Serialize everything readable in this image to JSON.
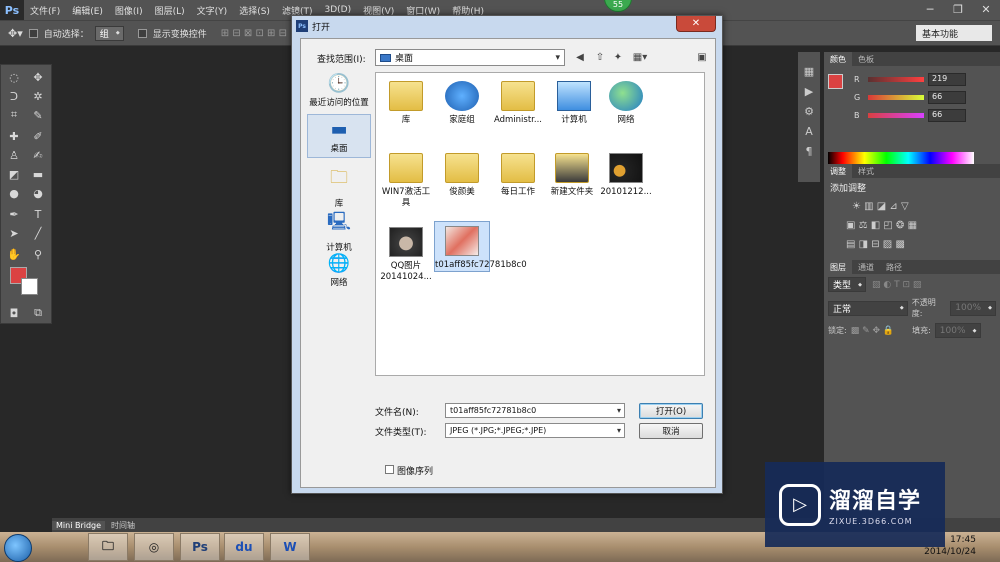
{
  "app": {
    "logo": "Ps",
    "badge": "55"
  },
  "menubar": [
    "文件(F)",
    "编辑(E)",
    "图像(I)",
    "图层(L)",
    "文字(Y)",
    "选择(S)",
    "滤镜(T)",
    "3D(D)",
    "视图(V)",
    "窗口(W)",
    "帮助(H)"
  ],
  "options": {
    "auto_select": "自动选择：",
    "group": "组",
    "show_transform": "显示变换控件"
  },
  "workspace": "基本功能",
  "color_panel": {
    "tabs": [
      "颜色",
      "色板"
    ],
    "channels": [
      {
        "label": "R",
        "value": "219"
      },
      {
        "label": "G",
        "value": "66"
      },
      {
        "label": "B",
        "value": "66"
      }
    ],
    "fg_color": "#db4242"
  },
  "adjust_panel": {
    "tabs": [
      "调整",
      "样式"
    ],
    "title": "添加调整"
  },
  "layers_panel": {
    "tabs": [
      "图层",
      "通道",
      "路径"
    ],
    "kind": "类型",
    "blend": "正常",
    "opacity_label": "不透明度:",
    "opacity": "100%",
    "lock_label": "锁定:",
    "fill_label": "填充:",
    "fill": "100%"
  },
  "bottom_tabs": [
    "Mini Bridge",
    "时间轴"
  ],
  "dialog": {
    "title": "打开",
    "lookin_label": "查找范围(I):",
    "lookin_value": "桌面",
    "places": [
      {
        "label": "最近访问的位置",
        "icon": "recent-places-icon"
      },
      {
        "label": "桌面",
        "icon": "desktop-icon"
      },
      {
        "label": "库",
        "icon": "libraries-icon"
      },
      {
        "label": "计算机",
        "icon": "computer-icon"
      },
      {
        "label": "网络",
        "icon": "network-icon"
      }
    ],
    "files": [
      {
        "label": "库",
        "icon": "libraries-icon"
      },
      {
        "label": "家庭组",
        "icon": "homegroup-icon"
      },
      {
        "label": "Administr...",
        "icon": "user-folder-icon"
      },
      {
        "label": "计算机",
        "icon": "computer-icon"
      },
      {
        "label": "网络",
        "icon": "network-icon"
      },
      {
        "label": "WIN7激活工具",
        "icon": "folder-icon"
      },
      {
        "label": "俊颜美",
        "icon": "folder-icon"
      },
      {
        "label": "每日工作",
        "icon": "folder-icon"
      },
      {
        "label": "新建文件夹",
        "icon": "folder-icon"
      },
      {
        "label": "20101212...",
        "icon": "image-thumbnail-icon"
      },
      {
        "label": "QQ图片20141024...",
        "icon": "image-thumbnail-icon"
      },
      {
        "label": "t01aff85fc72781b8c0",
        "icon": "image-thumbnail-icon"
      }
    ],
    "filename_label": "文件名(N):",
    "filename": "t01aff85fc72781b8c0",
    "filetype_label": "文件类型(T):",
    "filetype": "JPEG (*.JPG;*.JPEG;*.JPE)",
    "open_button": "打开(O)",
    "cancel_button": "取消",
    "sequence_label": "图像序列"
  },
  "taskbar": {
    "time": "17:45",
    "date": "2014/10/24",
    "apps": [
      "explorer",
      "360",
      "Ps",
      "baidu",
      "word"
    ]
  },
  "watermark": {
    "title": "溜溜自学",
    "url": "ZIXUE.3D66.COM"
  }
}
